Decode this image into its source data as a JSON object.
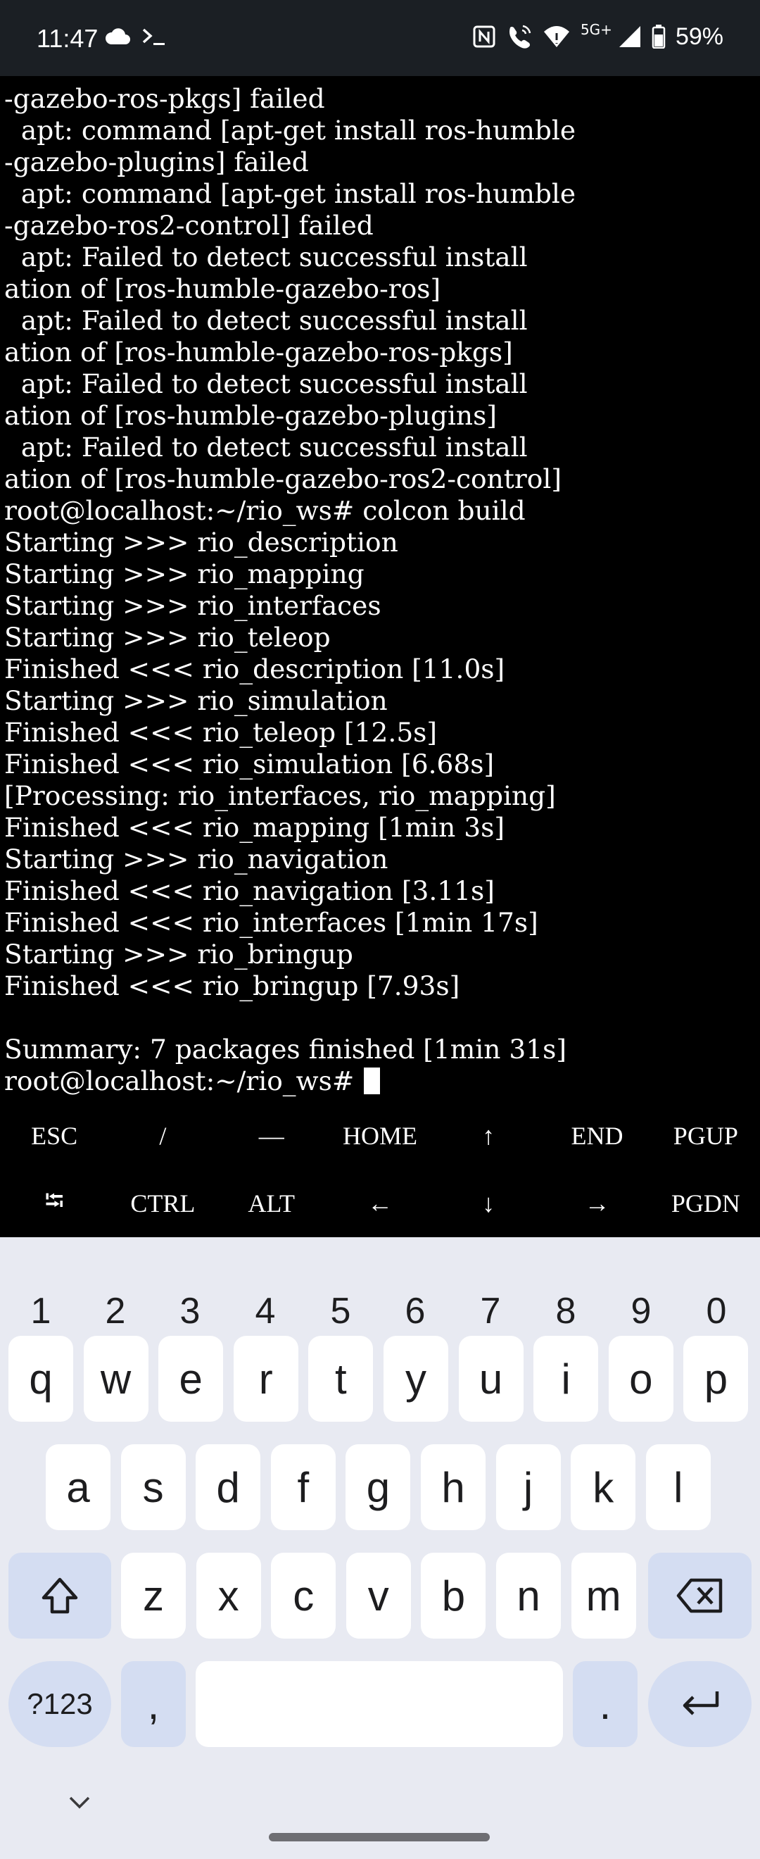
{
  "status_bar": {
    "time": "11:47",
    "network": "5G+",
    "battery": "59%",
    "icons": [
      "cloud-icon",
      "terminal-icon",
      "nfc-icon",
      "wifi-calling-icon",
      "wifi-icon",
      "signal-icon",
      "battery-icon"
    ]
  },
  "terminal": {
    "lines": [
      "-gazebo-ros-pkgs] failed",
      "  apt: command [apt-get install ros-humble",
      "-gazebo-plugins] failed",
      "  apt: command [apt-get install ros-humble",
      "-gazebo-ros2-control] failed",
      "  apt: Failed to detect successful install",
      "ation of [ros-humble-gazebo-ros]",
      "  apt: Failed to detect successful install",
      "ation of [ros-humble-gazebo-ros-pkgs]",
      "  apt: Failed to detect successful install",
      "ation of [ros-humble-gazebo-plugins]",
      "  apt: Failed to detect successful install",
      "ation of [ros-humble-gazebo-ros2-control]",
      "root@localhost:~/rio_ws# colcon build",
      "Starting >>> rio_description",
      "Starting >>> rio_mapping",
      "Starting >>> rio_interfaces",
      "Starting >>> rio_teleop",
      "Finished <<< rio_description [11.0s]",
      "Starting >>> rio_simulation",
      "Finished <<< rio_teleop [12.5s]",
      "Finished <<< rio_simulation [6.68s]",
      "[Processing: rio_interfaces, rio_mapping]",
      "Finished <<< rio_mapping [1min 3s]",
      "Starting >>> rio_navigation",
      "Finished <<< rio_navigation [3.11s]",
      "Finished <<< rio_interfaces [1min 17s]",
      "Starting >>> rio_bringup",
      "Finished <<< rio_bringup [7.93s]",
      "",
      "Summary: 7 packages finished [1min 31s]"
    ],
    "prompt": "root@localhost:~/rio_ws# "
  },
  "extra_keys": {
    "row1": [
      "ESC",
      "/",
      "—",
      "HOME",
      "↑",
      "END",
      "PGUP"
    ],
    "row2": [
      "⭾",
      "CTRL",
      "ALT",
      "←",
      "↓",
      "→",
      "PGDN"
    ]
  },
  "keyboard": {
    "numbers": [
      "1",
      "2",
      "3",
      "4",
      "5",
      "6",
      "7",
      "8",
      "9",
      "0"
    ],
    "row1": [
      "q",
      "w",
      "e",
      "r",
      "t",
      "y",
      "u",
      "i",
      "o",
      "p"
    ],
    "row2": [
      "a",
      "s",
      "d",
      "f",
      "g",
      "h",
      "j",
      "k",
      "l"
    ],
    "row3": [
      "z",
      "x",
      "c",
      "v",
      "b",
      "n",
      "m"
    ],
    "symbols_label": "?123",
    "comma": ",",
    "period": "."
  }
}
